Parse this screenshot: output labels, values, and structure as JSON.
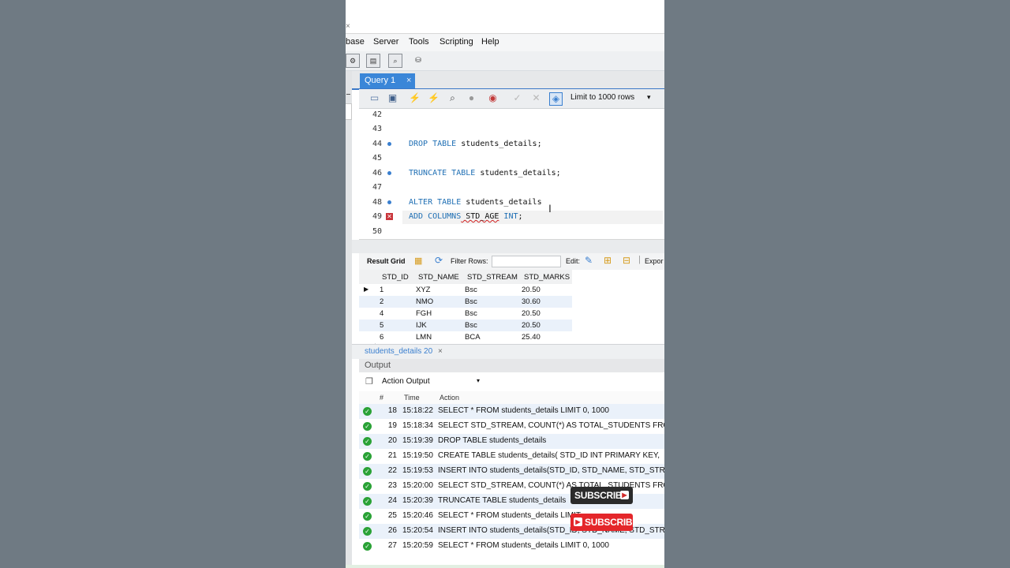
{
  "menu": {
    "items": [
      "base",
      "Server",
      "Tools",
      "Scripting",
      "Help"
    ]
  },
  "tab": {
    "label": "Query 1",
    "close": "×"
  },
  "sql_toolbar": {
    "limit_label": "Limit to 1000 rows",
    "caret": "▾"
  },
  "editor": {
    "lines": [
      {
        "num": "42",
        "marker": "",
        "kw": "",
        "text": ""
      },
      {
        "num": "43",
        "marker": "",
        "kw": "",
        "text": ""
      },
      {
        "num": "44",
        "marker": "dot",
        "kw": "DROP TABLE",
        "text": " students_details;"
      },
      {
        "num": "45",
        "marker": "",
        "kw": "",
        "text": ""
      },
      {
        "num": "46",
        "marker": "dot",
        "kw": "TRUNCATE TABLE",
        "text": " students_details;"
      },
      {
        "num": "47",
        "marker": "",
        "kw": "",
        "text": ""
      },
      {
        "num": "48",
        "marker": "dot",
        "kw": "ALTER TABLE",
        "text": " students_details"
      },
      {
        "num": "49",
        "marker": "error",
        "kw": "ADD COLUMNS",
        "text": " STD_AGE",
        "kw2": " INT",
        "tail": ";"
      },
      {
        "num": "50",
        "marker": "",
        "kw": "",
        "text": ""
      }
    ]
  },
  "result_toolbar": {
    "result_grid": "Result Grid",
    "filter_rows": "Filter Rows:",
    "edit": "Edit:",
    "export": "Expor"
  },
  "grid": {
    "columns": [
      "STD_ID",
      "STD_NAME",
      "STD_STREAM",
      "STD_MARKS"
    ],
    "rows": [
      [
        "1",
        "XYZ",
        "Bsc",
        "20.50"
      ],
      [
        "2",
        "NMO",
        "Bsc",
        "30.60"
      ],
      [
        "4",
        "FGH",
        "Bsc",
        "20.50"
      ],
      [
        "5",
        "IJK",
        "Bsc",
        "20.50"
      ],
      [
        "6",
        "LMN",
        "BCA",
        "25.40"
      ]
    ]
  },
  "result_tab": {
    "label": "students_details 20",
    "close": "×"
  },
  "output": {
    "header": "Output",
    "selector": "Action Output",
    "col_hash": "#",
    "col_time": "Time",
    "col_action": "Action",
    "rows": [
      {
        "num": "18",
        "time": "15:18:22",
        "action": "SELECT * FROM students_details LIMIT 0, 1000"
      },
      {
        "num": "19",
        "time": "15:18:34",
        "action": "SELECT STD_STREAM, COUNT(*) AS TOTAL_STUDENTS FROM"
      },
      {
        "num": "20",
        "time": "15:19:39",
        "action": "DROP TABLE students_details"
      },
      {
        "num": "21",
        "time": "15:19:50",
        "action": "CREATE TABLE students_details( STD_ID INT PRIMARY KEY,"
      },
      {
        "num": "22",
        "time": "15:19:53",
        "action": "INSERT INTO students_details(STD_ID, STD_NAME, STD_STREA"
      },
      {
        "num": "23",
        "time": "15:20:00",
        "action": "SELECT STD_STREAM, COUNT(*) AS TOTAL_STUDENTS FROM"
      },
      {
        "num": "24",
        "time": "15:20:39",
        "action": "TRUNCATE TABLE students_details"
      },
      {
        "num": "25",
        "time": "15:20:46",
        "action": "SELECT * FROM students_details LIMIT"
      },
      {
        "num": "26",
        "time": "15:20:54",
        "action": "INSERT INTO students_details(STD_ID, STD_NAME, STD_STREA"
      },
      {
        "num": "27",
        "time": "15:20:59",
        "action": "SELECT * FROM students_details LIMIT 0, 1000"
      }
    ]
  },
  "overlay": {
    "subscribe_dark": "SUBSCRIBE",
    "subscribe_red": "SUBSCRIBE"
  },
  "colors": {
    "accent": "#3a86d8",
    "keyword": "#1f6fb4",
    "success": "#2aa236",
    "subscribe_red": "#e4262a"
  }
}
